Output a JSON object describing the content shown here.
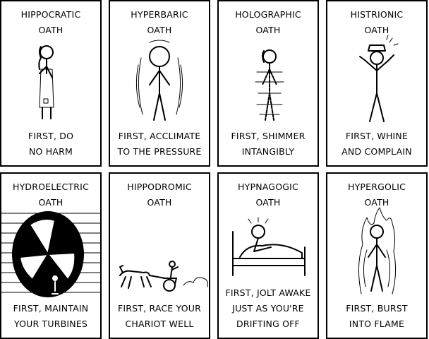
{
  "panels": [
    {
      "title": [
        "HIPPOCRATIC",
        "OATH"
      ],
      "caption": [
        "FIRST, DO",
        "NO HARM"
      ],
      "icon": "doctor-figure"
    },
    {
      "title": [
        "HYPERBARIC",
        "OATH"
      ],
      "caption": [
        "FIRST, ACCLIMATE",
        "TO THE PRESSURE"
      ],
      "icon": "pressured-figure"
    },
    {
      "title": [
        "HOLOGRAPHIC",
        "OATH"
      ],
      "caption": [
        "FIRST, SHIMMER",
        "INTANGIBLY"
      ],
      "icon": "hologram-figure"
    },
    {
      "title": [
        "HISTRIONIC",
        "OATH"
      ],
      "caption": [
        "FIRST, WHINE",
        "AND COMPLAIN"
      ],
      "icon": "dramatic-figure"
    },
    {
      "title": [
        "HYDROELECTRIC",
        "OATH"
      ],
      "caption": [
        "FIRST, MAINTAIN",
        "YOUR TURBINES"
      ],
      "icon": "turbine-wheel"
    },
    {
      "title": [
        "HIPPODROMIC",
        "OATH"
      ],
      "caption": [
        "FIRST, RACE YOUR",
        "CHARIOT WELL"
      ],
      "icon": "chariot"
    },
    {
      "title": [
        "HYPNAGOGIC",
        "OATH"
      ],
      "caption": [
        "FIRST, JOLT AWAKE",
        "JUST AS YOU'RE",
        "DRIFTING OFF"
      ],
      "icon": "bed-figure"
    },
    {
      "title": [
        "HYPERGOLIC",
        "OATH"
      ],
      "caption": [
        "FIRST, BURST",
        "INTO FLAME"
      ],
      "icon": "flaming-figure"
    }
  ]
}
